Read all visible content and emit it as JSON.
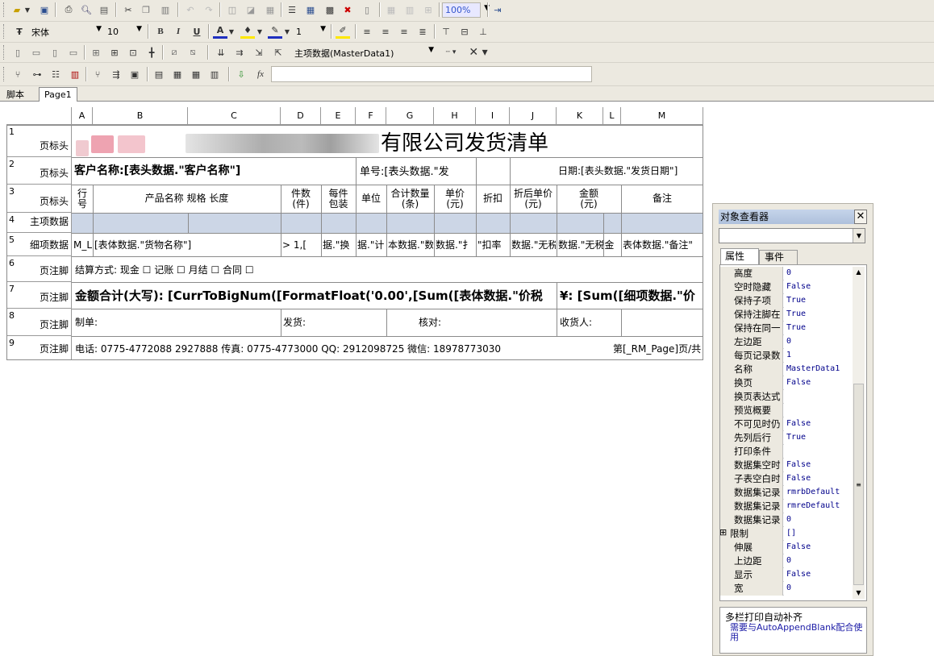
{
  "toolbar3": {
    "band_combo": "主项数据(MasterData1)"
  },
  "toolbar2": {
    "font_name": "宋体",
    "font_size": "10",
    "line_width": "1"
  },
  "toolbar1": {
    "zoom": "100%"
  },
  "toolbar4": {
    "fx_label": "fx",
    "expression": ""
  },
  "tabs": {
    "script": "脚本",
    "page1": "Page1"
  },
  "columns": [
    "A",
    "B",
    "C",
    "D",
    "E",
    "F",
    "G",
    "H",
    "I",
    "J",
    "K",
    "L",
    "M"
  ],
  "rows": [
    {
      "num": "1",
      "type": "页标头"
    },
    {
      "num": "2",
      "type": "页标头"
    },
    {
      "num": "3",
      "type": "页标头"
    },
    {
      "num": "4",
      "type": "主项数据"
    },
    {
      "num": "5",
      "type": "细项数据"
    },
    {
      "num": "6",
      "type": "页注脚"
    },
    {
      "num": "7",
      "type": "页注脚"
    },
    {
      "num": "8",
      "type": "页注脚"
    },
    {
      "num": "9",
      "type": "页注脚"
    }
  ],
  "report": {
    "title_suffix": "有限公司发货清单",
    "customer": "客户名称:[表头数据.\"客户名称\"]",
    "order_no": "单号:[表头数据.\"发",
    "date": "日期:[表头数据.\"发货日期\"]",
    "headers": {
      "row_no_1": "行",
      "row_no_2": "号",
      "product": "产品名称 规格 长度",
      "pieces_1": "件数",
      "pieces_2": "(件)",
      "per_pack_1": "每件",
      "per_pack_2": "包装",
      "unit": "单位",
      "total_qty_1": "合计数量",
      "total_qty_2": "(条)",
      "price_1": "单价",
      "price_2": "(元)",
      "discount": "折扣",
      "net_price_1": "折后单价",
      "net_price_2": "(元)",
      "amount_1": "金额",
      "amount_2": "(元)",
      "remark": "备注"
    },
    "detail": {
      "c_a": "M_Li",
      "goods": "[表体数据.\"货物名称\"]",
      "c_d": ">  1,[",
      "c_e": "据.\"换",
      "c_f": "据.\"计",
      "c_g": "本数据.\"数",
      "c_h": "数据.\"扌",
      "c_i": "\"扣率",
      "c_j": "数据.\"无税",
      "c_k": "数据.\"无税金",
      "c_m": "表体数据.\"备注\""
    },
    "settlement": "结算方式: 现金 ☐  记账 ☐  月结 ☐  合同 ☐",
    "amount_big": "金额合计(大写): [CurrToBigNum([FormatFloat('0.00',[Sum([表体数据.\"价税",
    "amount_small": "¥: [Sum([细项数据.\"价",
    "maker": "制单:",
    "shipper": "发货:",
    "checker": "核对:",
    "receiver": "收货人:",
    "contact": "电话: 0775-4772088  2927888  传真: 0775-4773000  QQ: 2912098725  微信: 18978773030",
    "page_no": "第[_RM_Page]页/共"
  },
  "inspector": {
    "title": "对象查看器",
    "tab_props": "属性",
    "tab_events": "事件",
    "props": [
      {
        "k": "高度",
        "v": "0"
      },
      {
        "k": "空时隐藏",
        "v": "False"
      },
      {
        "k": "保持子项",
        "v": "True"
      },
      {
        "k": "保持注脚在",
        "v": "True"
      },
      {
        "k": "保持在同一",
        "v": "True"
      },
      {
        "k": "左边距",
        "v": "0"
      },
      {
        "k": "每页记录数",
        "v": "1"
      },
      {
        "k": "名称",
        "v": "MasterData1"
      },
      {
        "k": "换页",
        "v": "False"
      },
      {
        "k": "换页表达式",
        "v": ""
      },
      {
        "k": "预览概要",
        "v": ""
      },
      {
        "k": "不可见时仍",
        "v": "False"
      },
      {
        "k": "先列后行",
        "v": "True"
      },
      {
        "k": "打印条件",
        "v": ""
      },
      {
        "k": "数据集空时",
        "v": "False"
      },
      {
        "k": "子表空白时",
        "v": "False"
      },
      {
        "k": "数据集记录",
        "v": "rmrbDefault"
      },
      {
        "k": "数据集记录",
        "v": "rmreDefault"
      },
      {
        "k": "数据集记录",
        "v": "0"
      },
      {
        "k": "限制",
        "v": "[]"
      },
      {
        "k": "伸展",
        "v": "False"
      },
      {
        "k": "上边距",
        "v": "0"
      },
      {
        "k": "显示",
        "v": "False"
      },
      {
        "k": "宽",
        "v": "0"
      }
    ],
    "desc_title": "多栏打印自动补齐",
    "desc_text": "需要与AutoAppendBlank配合使用"
  }
}
